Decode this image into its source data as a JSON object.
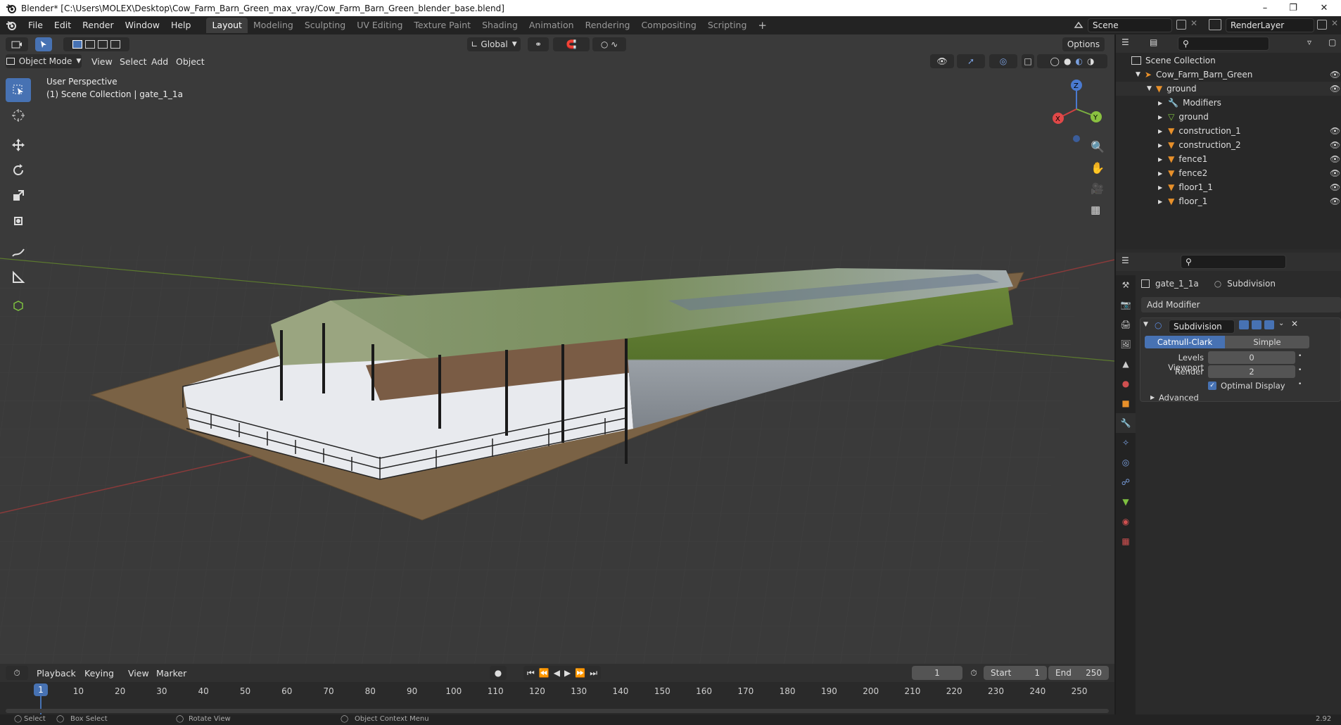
{
  "window": {
    "title": "Blender* [C:\\Users\\MOLEX\\Desktop\\Cow_Farm_Barn_Green_max_vray/Cow_Farm_Barn_Green_blender_base.blend]"
  },
  "menubar": {
    "items": [
      "File",
      "Edit",
      "Render",
      "Window",
      "Help"
    ]
  },
  "workspaces": [
    "Layout",
    "Modeling",
    "Sculpting",
    "UV Editing",
    "Texture Paint",
    "Shading",
    "Animation",
    "Rendering",
    "Compositing",
    "Scripting"
  ],
  "scene": {
    "name": "Scene",
    "view_layer": "RenderLayer"
  },
  "viewport": {
    "mode": "Object Mode",
    "menus": [
      "View",
      "Select",
      "Add",
      "Object"
    ],
    "orientation": "Global",
    "options_label": "Options",
    "info_line1": "User Perspective",
    "info_line2": "(1) Scene Collection | gate_1_1a",
    "gizmo": {
      "x": "X",
      "y": "Y",
      "z": "Z"
    }
  },
  "outliner": {
    "root": "Scene Collection",
    "collection": "Cow_Farm_Barn_Green",
    "object": "ground",
    "children": [
      {
        "label": "Modifiers",
        "icon": "wrench-icon"
      },
      {
        "label": "ground",
        "icon": "mesh-data-icon"
      },
      {
        "label": "construction_1",
        "icon": "object-icon"
      },
      {
        "label": "construction_2",
        "icon": "object-icon"
      },
      {
        "label": "fence1",
        "icon": "object-icon"
      },
      {
        "label": "fence2",
        "icon": "object-icon"
      },
      {
        "label": "floor1_1",
        "icon": "object-icon"
      },
      {
        "label": "floor_1",
        "icon": "object-icon"
      }
    ]
  },
  "properties": {
    "object_name": "gate_1_1a",
    "modifier_context": "Subdivision",
    "add_modifier": "Add Modifier",
    "modifier": {
      "name": "Subdivision",
      "mode_active": "Catmull-Clark",
      "mode_other": "Simple",
      "levels_viewport_label": "Levels Viewport",
      "levels_viewport": "0",
      "render_label": "Render",
      "render": "2",
      "optimal_display_label": "Optimal Display",
      "advanced_label": "Advanced"
    }
  },
  "timeline": {
    "menus": [
      "Playback",
      "Keying",
      "View",
      "Marker"
    ],
    "current_frame": "1",
    "start_label": "Start",
    "start": "1",
    "end_label": "End",
    "end": "250",
    "ticks": [
      "10",
      "20",
      "30",
      "40",
      "50",
      "60",
      "70",
      "80",
      "90",
      "100",
      "110",
      "120",
      "130",
      "140",
      "150",
      "160",
      "170",
      "180",
      "190",
      "200",
      "210",
      "220",
      "230",
      "240",
      "250"
    ],
    "playhead": "1"
  },
  "statusbar": {
    "select": "Select",
    "box_select": "Box Select",
    "rotate_view": "Rotate View",
    "context_menu": "Object Context Menu",
    "version": "2.92"
  },
  "colors": {
    "accent": "#4772b3",
    "header": "#303030",
    "viewport_bg": "#3a3a3a",
    "object_orange": "#e8902a",
    "mesh_green": "#7ec040"
  }
}
